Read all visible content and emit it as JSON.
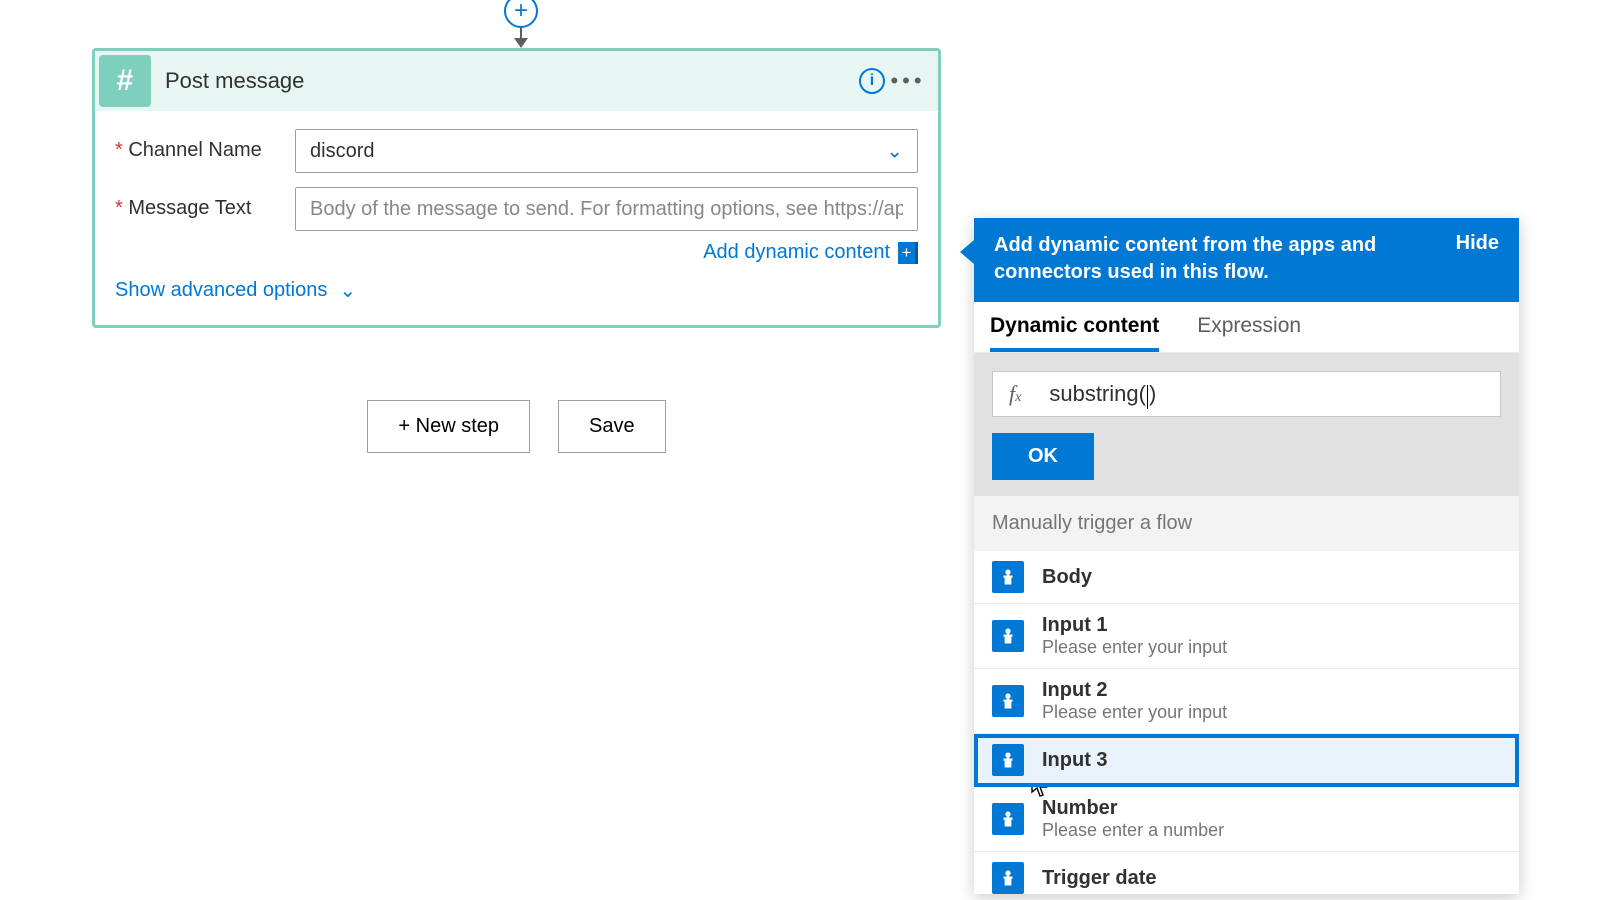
{
  "connector": {
    "step_title": "Post message",
    "icon_name": "hash-icon"
  },
  "fields": {
    "channel": {
      "label": "Channel Name",
      "required": true,
      "value": "discord"
    },
    "message": {
      "label": "Message Text",
      "required": true,
      "placeholder": "Body of the message to send. For formatting options, see https://api.slack.com."
    }
  },
  "links": {
    "add_dynamic": "Add dynamic content",
    "show_advanced": "Show advanced options"
  },
  "buttons": {
    "new_step": "+ New step",
    "save": "Save",
    "ok": "OK",
    "hide": "Hide"
  },
  "flyout": {
    "intro": "Add dynamic content from the apps and connectors used in this flow.",
    "tabs": {
      "dynamic": "Dynamic content",
      "expression": "Expression"
    },
    "expression_value": "substring()",
    "caret_index": 10,
    "section_title": "Manually trigger a flow",
    "items": [
      {
        "name": "Body",
        "desc": "",
        "selected": false
      },
      {
        "name": "Input 1",
        "desc": "Please enter your input",
        "selected": false
      },
      {
        "name": "Input 2",
        "desc": "Please enter your input",
        "selected": false
      },
      {
        "name": "Input 3",
        "desc": "",
        "selected": true
      },
      {
        "name": "Number",
        "desc": "Please enter a number",
        "selected": false
      },
      {
        "name": "Trigger date",
        "desc": "",
        "selected": false
      }
    ]
  }
}
